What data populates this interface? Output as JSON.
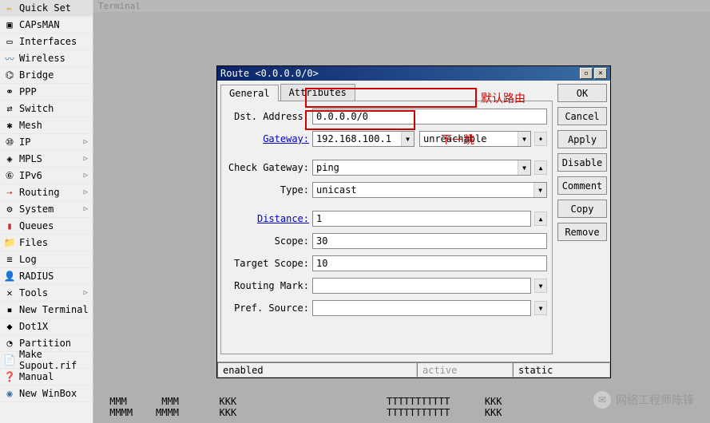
{
  "terminal_header": "Terminal",
  "sidebar": {
    "items": [
      {
        "icon": "✏",
        "label": "Quick Set",
        "expand": false,
        "ic": "i-yellow"
      },
      {
        "icon": "▣",
        "label": "CAPsMAN",
        "expand": false,
        "ic": ""
      },
      {
        "icon": "▭",
        "label": "Interfaces",
        "expand": false,
        "ic": ""
      },
      {
        "icon": "〰",
        "label": "Wireless",
        "expand": false,
        "ic": "i-blue"
      },
      {
        "icon": "⌬",
        "label": "Bridge",
        "expand": false,
        "ic": ""
      },
      {
        "icon": "⚭",
        "label": "PPP",
        "expand": false,
        "ic": ""
      },
      {
        "icon": "⇄",
        "label": "Switch",
        "expand": false,
        "ic": ""
      },
      {
        "icon": "✱",
        "label": "Mesh",
        "expand": false,
        "ic": ""
      },
      {
        "icon": "⑩",
        "label": "IP",
        "expand": true,
        "ic": ""
      },
      {
        "icon": "◈",
        "label": "MPLS",
        "expand": true,
        "ic": ""
      },
      {
        "icon": "⑥",
        "label": "IPv6",
        "expand": true,
        "ic": ""
      },
      {
        "icon": "⇢",
        "label": "Routing",
        "expand": true,
        "ic": "i-red"
      },
      {
        "icon": "⚙",
        "label": "System",
        "expand": true,
        "ic": ""
      },
      {
        "icon": "▮",
        "label": "Queues",
        "expand": false,
        "ic": "i-red"
      },
      {
        "icon": "📁",
        "label": "Files",
        "expand": false,
        "ic": "i-blue"
      },
      {
        "icon": "≡",
        "label": "Log",
        "expand": false,
        "ic": ""
      },
      {
        "icon": "👤",
        "label": "RADIUS",
        "expand": false,
        "ic": "i-yellow"
      },
      {
        "icon": "✕",
        "label": "Tools",
        "expand": true,
        "ic": ""
      },
      {
        "icon": "▪",
        "label": "New Terminal",
        "expand": false,
        "ic": ""
      },
      {
        "icon": "◆",
        "label": "Dot1X",
        "expand": false,
        "ic": ""
      },
      {
        "icon": "◔",
        "label": "Partition",
        "expand": false,
        "ic": ""
      },
      {
        "icon": "📄",
        "label": "Make Supout.rif",
        "expand": false,
        "ic": ""
      },
      {
        "icon": "❓",
        "label": "Manual",
        "expand": false,
        "ic": "i-blue"
      },
      {
        "icon": "◉",
        "label": "New WinBox",
        "expand": false,
        "ic": "i-blue"
      }
    ]
  },
  "dialog": {
    "title": "Route <0.0.0.0/0>",
    "tabs": [
      {
        "label": "General",
        "active": true
      },
      {
        "label": "Attributes",
        "active": false
      }
    ],
    "fields": {
      "dst_address_label": "Dst. Address:",
      "dst_address": "0.0.0.0/0",
      "gateway_label": "Gateway:",
      "gateway": "192.168.100.1",
      "gateway_status": "unreachable",
      "check_gateway_label": "Check Gateway:",
      "check_gateway": "ping",
      "type_label": "Type:",
      "type": "unicast",
      "distance_label": "Distance:",
      "distance": "1",
      "scope_label": "Scope:",
      "scope": "30",
      "target_scope_label": "Target Scope:",
      "target_scope": "10",
      "routing_mark_label": "Routing Mark:",
      "routing_mark": "",
      "pref_source_label": "Pref. Source:",
      "pref_source": ""
    },
    "buttons": {
      "ok": "OK",
      "cancel": "Cancel",
      "apply": "Apply",
      "disable": "Disable",
      "comment": "Comment",
      "copy": "Copy",
      "remove": "Remove"
    },
    "status": {
      "enabled": "enabled",
      "active": "active",
      "static": "static"
    }
  },
  "annotations": {
    "default_route": "默认路由",
    "next_hop": "下一跳"
  },
  "terminal_output": {
    "line1": " MMM      MMM       KKK                          TTTTTTTTTTT      KKK",
    "line2": " MMMM    MMMM       KKK                          TTTTTTTTTTT      KKK"
  },
  "watermark": "网络工程师陈锋"
}
